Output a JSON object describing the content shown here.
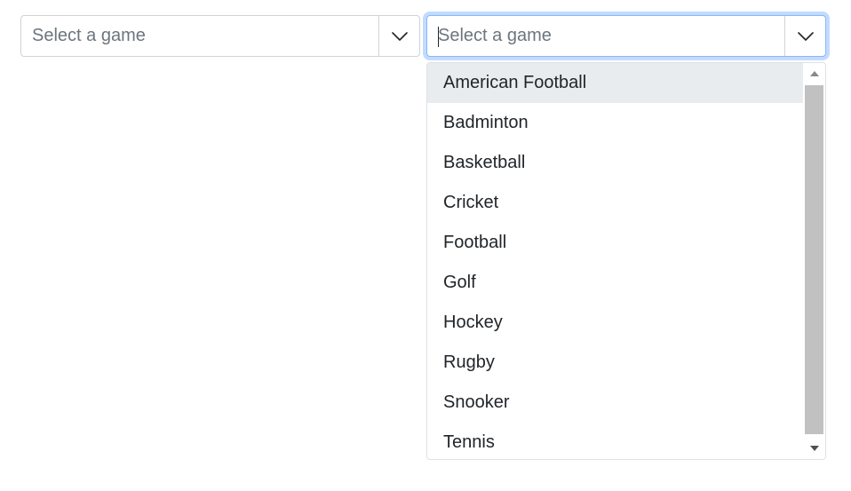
{
  "combo1": {
    "placeholder": "Select a game",
    "value": ""
  },
  "combo2": {
    "placeholder": "Select a game",
    "value": "",
    "open": true
  },
  "dropdown": {
    "options": [
      "American Football",
      "Badminton",
      "Basketball",
      "Cricket",
      "Football",
      "Golf",
      "Hockey",
      "Rugby",
      "Snooker",
      "Tennis"
    ],
    "highlighted_index": 0
  },
  "icons": {
    "toggle": "chevron-down-icon",
    "scroll_up": "scroll-up-arrow-icon",
    "scroll_down": "scroll-down-arrow-icon"
  },
  "colors": {
    "focus_border": "#86b7fe",
    "highlight_bg": "#e9ecef",
    "placeholder": "#6c757d",
    "scroll_thumb": "#c1c1c1"
  }
}
